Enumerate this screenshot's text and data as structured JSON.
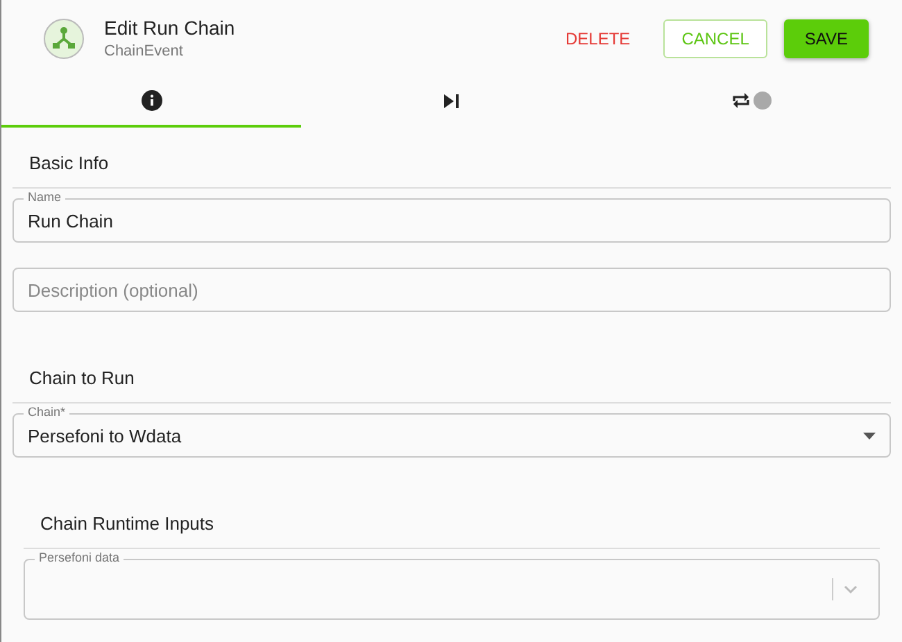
{
  "header": {
    "title": "Edit Run Chain",
    "subtitle": "ChainEvent",
    "buttons": [
      {
        "kind": "delete",
        "label": "DELETE"
      },
      {
        "kind": "cancel",
        "label": "CANCEL"
      },
      {
        "kind": "save",
        "label": "SAVE"
      }
    ]
  },
  "tabs": [
    {
      "kind": "info",
      "selected": true
    },
    {
      "kind": "next",
      "selected": false
    },
    {
      "kind": "repeat",
      "selected": false
    }
  ],
  "sections": [
    {
      "title": "Basic Info",
      "nested": false,
      "fields": [
        {
          "kind": "text",
          "label": "Name",
          "value": "Run Chain"
        },
        {
          "kind": "text",
          "placeholder": "Description (optional)"
        }
      ]
    },
    {
      "title": "Chain to Run",
      "nested": false,
      "fields": [
        {
          "kind": "select",
          "label": "Chain*",
          "value": "Persefoni to Wdata"
        }
      ]
    },
    {
      "title": "Chain Runtime Inputs",
      "nested": true,
      "fields": [
        {
          "kind": "combo",
          "label": "Persefoni data"
        }
      ]
    }
  ]
}
